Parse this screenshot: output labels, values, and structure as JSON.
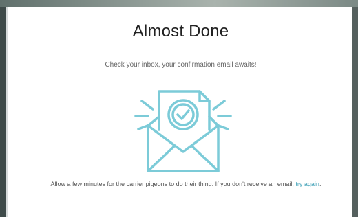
{
  "dialog": {
    "title": "Almost Done",
    "subtitle": "Check your inbox, your confirmation email awaits!",
    "note_text": "Allow a few minutes for the carrier pigeons to do their thing. If you don't receive an email, ",
    "retry_link": "try again",
    "note_end": ".",
    "illustration_icon": "envelope-check-icon",
    "accent_color": "#7ccbd8"
  }
}
